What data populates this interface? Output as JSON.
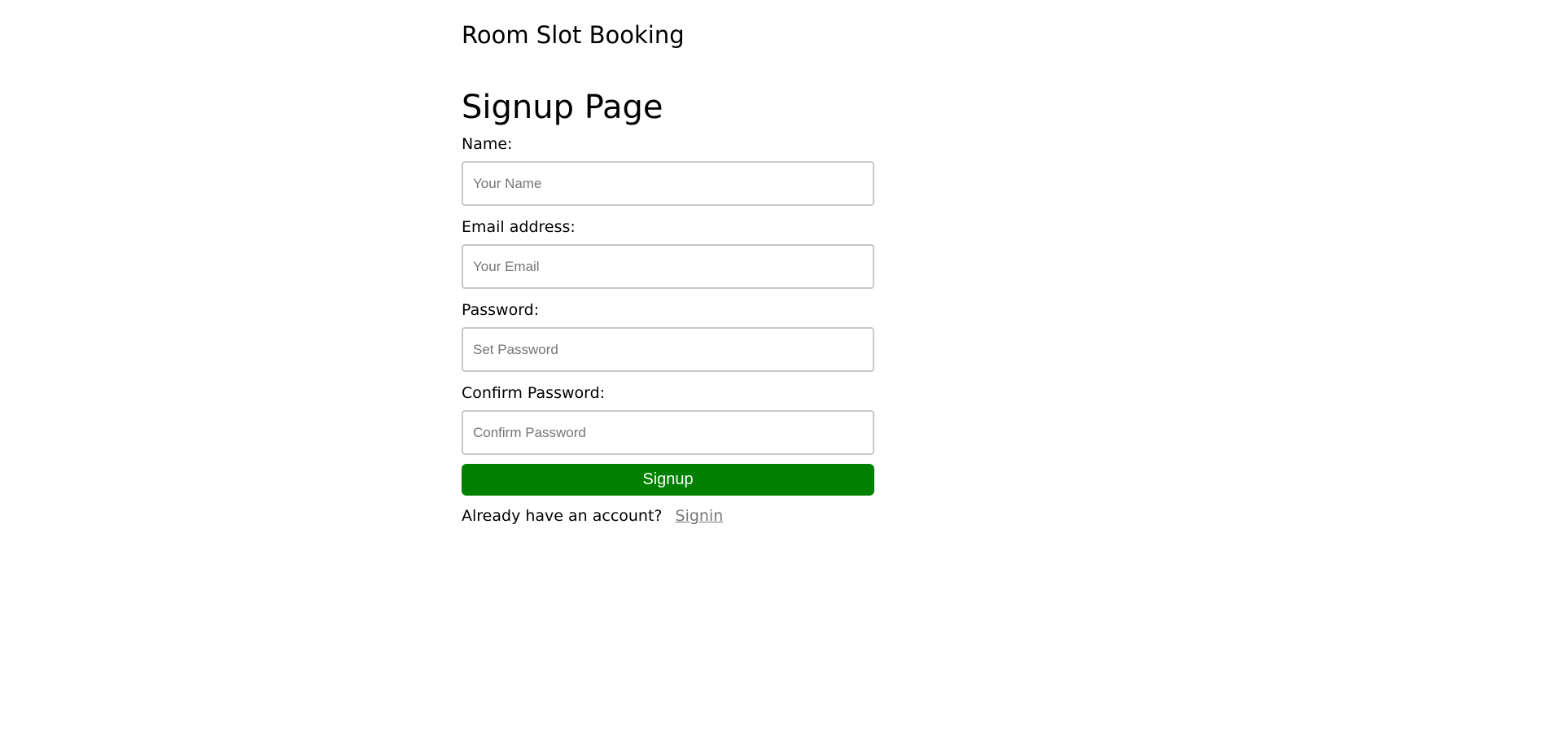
{
  "header": {
    "app_title": "Room Slot Booking"
  },
  "main": {
    "page_title": "Signup Page",
    "fields": {
      "name": {
        "label": "Name:",
        "placeholder": "Your Name",
        "value": ""
      },
      "email": {
        "label": "Email address:",
        "placeholder": "Your Email",
        "value": ""
      },
      "password": {
        "label": "Password:",
        "placeholder": "Set Password",
        "value": ""
      },
      "confirm_password": {
        "label": "Confirm Password:",
        "placeholder": "Confirm Password",
        "value": ""
      }
    },
    "signup_button_label": "Signup",
    "signin_prompt": "Already have an account?",
    "signin_link_label": "Signin"
  },
  "colors": {
    "signup_button_bg": "#008000",
    "signin_link": "#777777"
  }
}
